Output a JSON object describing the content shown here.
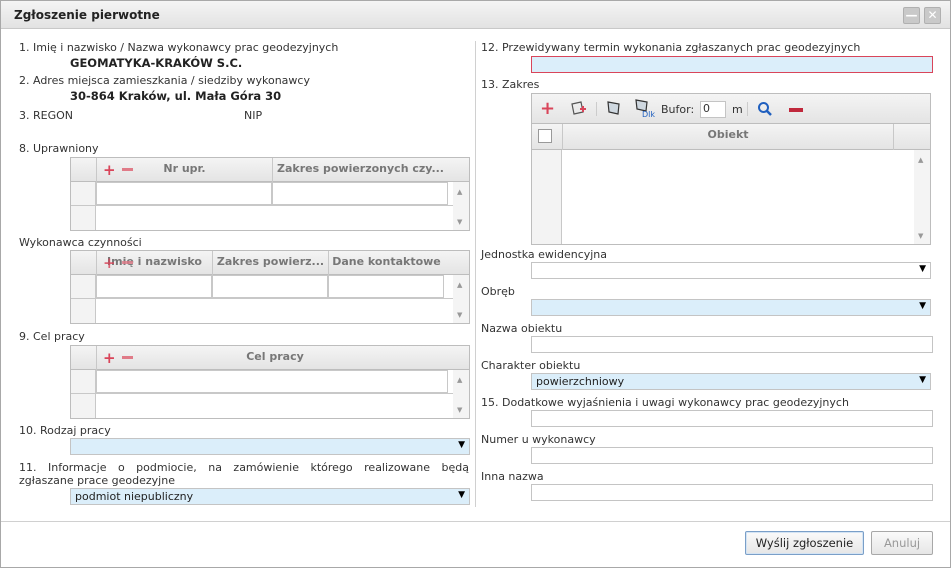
{
  "dialog": {
    "title": "Zgłoszenie pierwotne",
    "minimize_glyph": "—",
    "close_glyph": "✕"
  },
  "left": {
    "f1_label": "1. Imię i nazwisko / Nazwa wykonawcy prac geodezyjnych",
    "f1_value": "GEOMATYKA-KRAKÓW S.C.",
    "f2_label": "2. Adres miejsca zamieszkania / siedziby wykonawcy",
    "f2_value": "30-864 Kraków, ul. Mała Góra 30",
    "f3_regon_label": "3. REGON",
    "f3_nip_label": "NIP",
    "f8_label": "8. Uprawniony",
    "f8_cols": [
      "Nr upr.",
      "Zakres powierzonych czy..."
    ],
    "contractor_label": "Wykonawca czynności",
    "contractor_cols": [
      "Imię i nazwisko",
      "Zakres powierz...",
      "Dane kontaktowe"
    ],
    "f9_label": "9. Cel pracy",
    "f9_cols": [
      "Cel pracy"
    ],
    "f10_label": "10. Rodzaj pracy",
    "f10_value": "",
    "f11_label_line1": "11. Informacje o podmiocie, na zamówienie którego realizowane będą",
    "f11_label_line2": "zgłaszane prace geodezyjne",
    "f11_value": "podmiot niepubliczny"
  },
  "right": {
    "f12_label": "12. Przewidywany termin wykonania zgłaszanych prac geodezyjnych",
    "f12_value": "",
    "f13_label": "13. Zakres",
    "buffer_label": "Bufor:",
    "buffer_value": "0",
    "buffer_unit": "m",
    "dlk_label": "Dlk",
    "obj_col": "Obiekt",
    "unit_label": "Jednostka ewidencyjna",
    "unit_value": "",
    "precinct_label": "Obręb",
    "precinct_value": "",
    "objname_label": "Nazwa obiektu",
    "objname_value": "",
    "character_label": "Charakter obiektu",
    "character_value": "powierzchniowy",
    "f15_label": "15. Dodatkowe wyjaśnienia i uwagi wykonawcy prac geodezyjnych",
    "f15_value": "",
    "contractor_num_label": "Numer u wykonawcy",
    "contractor_num_value": "",
    "other_name_label": "Inna nazwa",
    "other_name_value": ""
  },
  "footer": {
    "submit_label": "Wyślij zgłoszenie",
    "cancel_label": "Anuluj"
  },
  "colors": {
    "accent_red": "#d9455a",
    "field_blue": "#dbeefa",
    "search_blue": "#1f5fbf"
  }
}
